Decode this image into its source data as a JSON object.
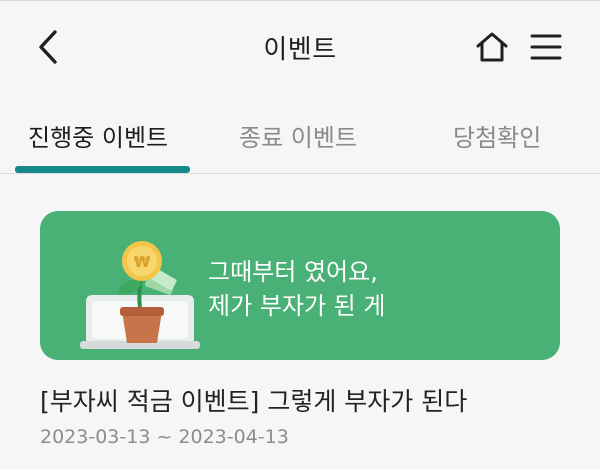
{
  "header": {
    "title": "이벤트",
    "back_icon": "chevron-left-icon",
    "home_icon": "home-icon",
    "menu_icon": "hamburger-menu-icon"
  },
  "tabs": [
    {
      "label": "진행중 이벤트",
      "active": true
    },
    {
      "label": "종료 이벤트",
      "active": false
    },
    {
      "label": "당첨확인",
      "active": false
    }
  ],
  "colors": {
    "accent": "#17898a",
    "banner_bg": "#49b076"
  },
  "events": [
    {
      "banner_line1": "그때부터 였어요,",
      "banner_line2": "제가 부자가 된 게",
      "banner_icon": "money-plant-pot-icon",
      "title": "[부자씨 적금 이벤트] 그렇게 부자가 된다",
      "period": "2023-03-13 ~ 2023-04-13"
    }
  ]
}
